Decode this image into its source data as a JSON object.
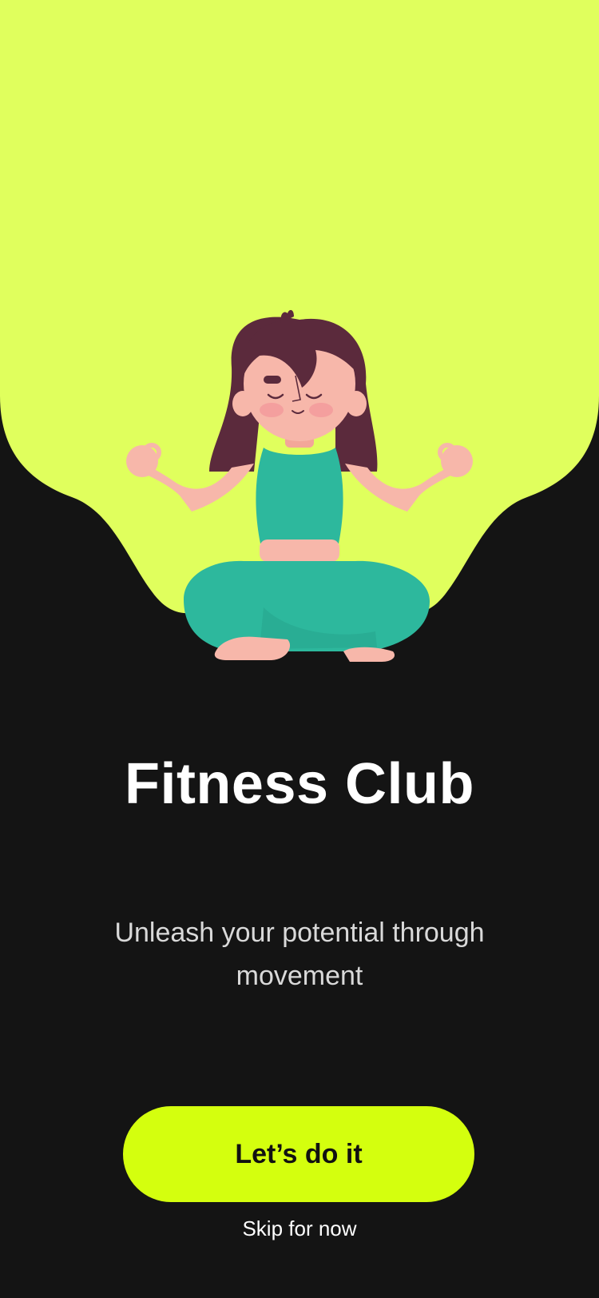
{
  "app": {
    "title": "Fitness Club",
    "tagline": "Unleash your potential through movement"
  },
  "actions": {
    "primary_label": "Let’s do it",
    "skip_label": "Skip for now"
  },
  "colors": {
    "background": "#141414",
    "hero_blob": "#e0ff5d",
    "button": "#d4ff0e",
    "outfit": "#2db89d",
    "skin": "#f7b7aa",
    "hair": "#5b2a3c"
  },
  "illustration": {
    "icon": "meditating-woman-illustration"
  }
}
